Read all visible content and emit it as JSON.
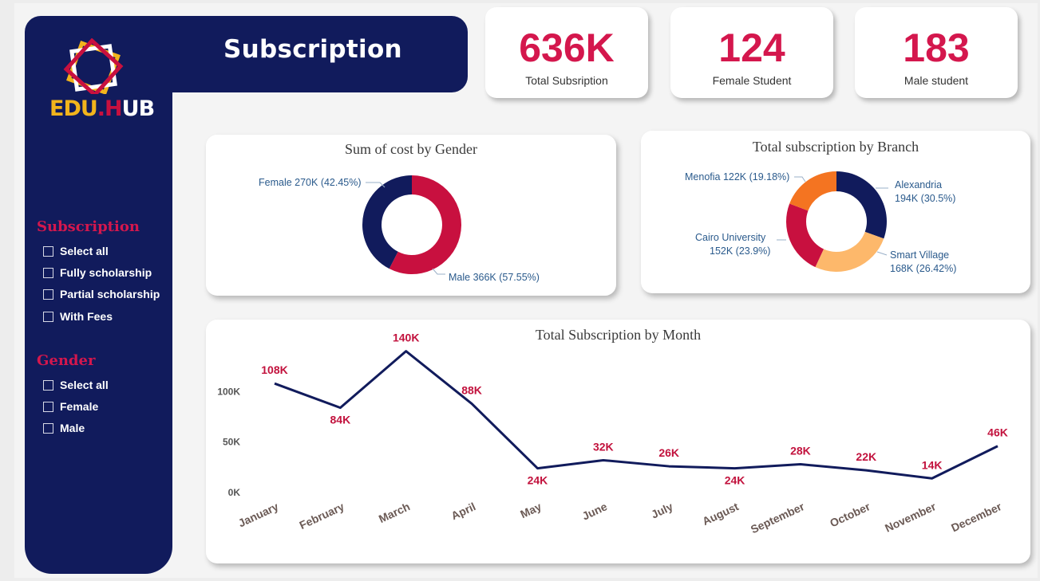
{
  "header": {
    "title": "Subscription"
  },
  "brand": {
    "logo_text_edu": "EDU",
    "logo_text_dot": ".",
    "logo_text_h": "H",
    "logo_text_ub": "UB",
    "logo_icon": "edu-hub-logo-icon"
  },
  "kpis": [
    {
      "value": "636K",
      "label": "Total Subsription"
    },
    {
      "value": "124",
      "label": "Female Student"
    },
    {
      "value": "183",
      "label": "Male student"
    }
  ],
  "slicers": {
    "subscription": {
      "title": "Subscription",
      "options": [
        "Select all",
        "Fully scholarship",
        "Partial scholarship",
        "With Fees"
      ]
    },
    "gender": {
      "title": "Gender",
      "options": [
        "Select all",
        "Female",
        "Male"
      ]
    }
  },
  "colors": {
    "navy": "#111b5c",
    "crimson": "#c8103f",
    "orange": "#f47421",
    "peach": "#fdb86b",
    "accent": "#d4174d"
  },
  "chart_data": [
    {
      "type": "pie",
      "title": "Sum of cost by Gender",
      "slices": [
        {
          "name": "Female",
          "value": 270,
          "percent": 42.45,
          "label": "Female 270K (42.45%)",
          "color": "#111b5c"
        },
        {
          "name": "Male",
          "value": 366,
          "percent": 57.55,
          "label": "Male 366K (57.55%)",
          "color": "#c8103f"
        }
      ]
    },
    {
      "type": "pie",
      "title": "Total subscription by Branch",
      "slices": [
        {
          "name": "Alexandria",
          "value": 194,
          "percent": 30.5,
          "label_line1": "Alexandria",
          "label_line2": "194K (30.5%)",
          "color": "#111b5c"
        },
        {
          "name": "Smart Village",
          "value": 168,
          "percent": 26.42,
          "label_line1": "Smart Village",
          "label_line2": "168K (26.42%)",
          "color": "#fdb86b"
        },
        {
          "name": "Cairo University",
          "value": 152,
          "percent": 23.9,
          "label_line1": "Cairo University",
          "label_line2": "152K (23.9%)",
          "color": "#c8103f"
        },
        {
          "name": "Menofia",
          "value": 122,
          "percent": 19.18,
          "label_line1": "Menofia 122K (19.18%)",
          "label_line2": "",
          "color": "#f47421"
        }
      ]
    },
    {
      "type": "line",
      "title": "Total Subscription by Month",
      "categories": [
        "January",
        "February",
        "March",
        "April",
        "May",
        "June",
        "July",
        "August",
        "September",
        "October",
        "November",
        "December"
      ],
      "values": [
        108,
        84,
        140,
        88,
        24,
        32,
        26,
        24,
        28,
        22,
        14,
        46
      ],
      "value_labels": [
        "108K",
        "84K",
        "140K",
        "88K",
        "24K",
        "32K",
        "26K",
        "24K",
        "28K",
        "22K",
        "14K",
        "46K"
      ],
      "yticks": [
        "0K",
        "50K",
        "100K"
      ],
      "ylim": [
        0,
        150
      ],
      "color": "#111b5c"
    }
  ]
}
